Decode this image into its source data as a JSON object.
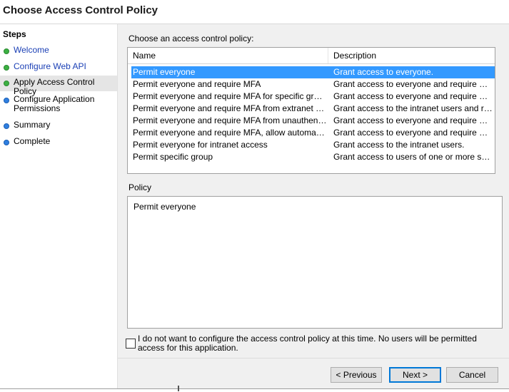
{
  "page": {
    "title": "Choose Access Control Policy"
  },
  "steps": {
    "title": "Steps",
    "items": [
      {
        "label": "Welcome",
        "status": "done"
      },
      {
        "label": "Configure Web API",
        "status": "done"
      },
      {
        "label": "Apply Access Control Policy",
        "status": "current"
      },
      {
        "label": "Configure Application Permissions",
        "status": "pending"
      },
      {
        "label": "Summary",
        "status": "pending"
      },
      {
        "label": "Complete",
        "status": "pending"
      }
    ]
  },
  "main": {
    "choose_label": "Choose an access control policy:",
    "columns": {
      "name": "Name",
      "description": "Description"
    },
    "rows": [
      {
        "name": "Permit everyone",
        "description": "Grant access to everyone.",
        "selected": true
      },
      {
        "name": "Permit everyone and require MFA",
        "description": "Grant access to everyone and require MFA f..."
      },
      {
        "name": "Permit everyone and require MFA for specific group",
        "description": "Grant access to everyone and require MFA f..."
      },
      {
        "name": "Permit everyone and require MFA from extranet access",
        "description": "Grant access to the intranet users and requir..."
      },
      {
        "name": "Permit everyone and require MFA from unauthenticated ...",
        "description": "Grant access to everyone and require MFA f..."
      },
      {
        "name": "Permit everyone and require MFA, allow automatic devi...",
        "description": "Grant access to everyone and require MFA f..."
      },
      {
        "name": "Permit everyone for intranet access",
        "description": "Grant access to the intranet users."
      },
      {
        "name": "Permit specific group",
        "description": "Grant access to users of one or more specifi..."
      }
    ],
    "policy_label": "Policy",
    "policy_text": "Permit everyone",
    "checkbox_label": "I do not want to configure the access control policy at this time.  No users will be permitted access for this application.",
    "checkbox_checked": false
  },
  "buttons": {
    "previous": "< Previous",
    "next": "Next >",
    "cancel": "Cancel"
  },
  "colors": {
    "selection": "#3399ff",
    "link": "#1a3fb5",
    "done_dot": "#3cb043",
    "pending_dot": "#2f7fe0"
  }
}
